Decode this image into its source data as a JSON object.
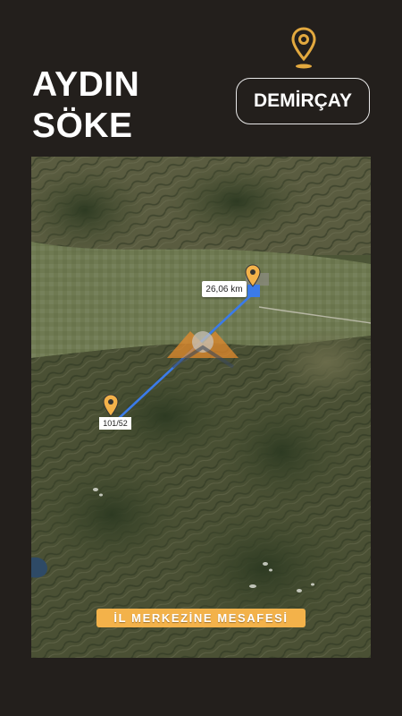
{
  "header": {
    "province": "AYDIN",
    "district": "SÖKE",
    "destination": "DEMİRÇAY"
  },
  "map": {
    "distance_label": "26,06 km",
    "parcel_label": "101/52",
    "footer_label": "İL MERKEZİNE MESAFESİ"
  },
  "icons": {
    "header_pin": "location-pin-icon",
    "map_pin": "location-pin-icon"
  },
  "colors": {
    "background": "#231f1c",
    "accent": "#f3b24a",
    "route_line": "#3b7be8"
  }
}
